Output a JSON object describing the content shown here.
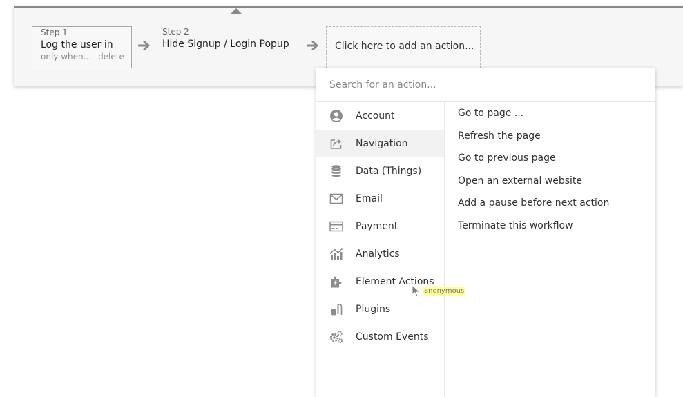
{
  "workflow": {
    "step1": {
      "label": "Step 1",
      "title": "Log the user in",
      "only_when": "only when...",
      "delete": "delete"
    },
    "step2": {
      "label": "Step 2",
      "title": "Hide Signup / Login Popup"
    },
    "add_action": "Click here to add an action..."
  },
  "popup": {
    "search_placeholder": "Search for an action...",
    "categories": [
      {
        "label": "Account",
        "icon": "account-icon"
      },
      {
        "label": "Navigation",
        "icon": "navigation-icon",
        "active": true
      },
      {
        "label": "Data (Things)",
        "icon": "database-icon"
      },
      {
        "label": "Email",
        "icon": "email-icon"
      },
      {
        "label": "Payment",
        "icon": "credit-card-icon"
      },
      {
        "label": "Analytics",
        "icon": "analytics-icon"
      },
      {
        "label": "Element Actions",
        "icon": "puzzle-icon"
      },
      {
        "label": "Plugins",
        "icon": "plugins-icon"
      },
      {
        "label": "Custom Events",
        "icon": "gears-icon"
      }
    ],
    "actions": [
      "Go to page ...",
      "Refresh the page",
      "Go to previous page",
      "Open an external website",
      "Add a pause before next action",
      "Terminate this workflow"
    ]
  },
  "cursor_badge": "anonymous",
  "colors": {
    "panel_bg": "#f6f6f6",
    "panel_top_border": "#8a8a8a",
    "icon_gray": "#8c8c8c",
    "active_row": "#f2f2f2",
    "badge_bg": "#ffff99"
  }
}
